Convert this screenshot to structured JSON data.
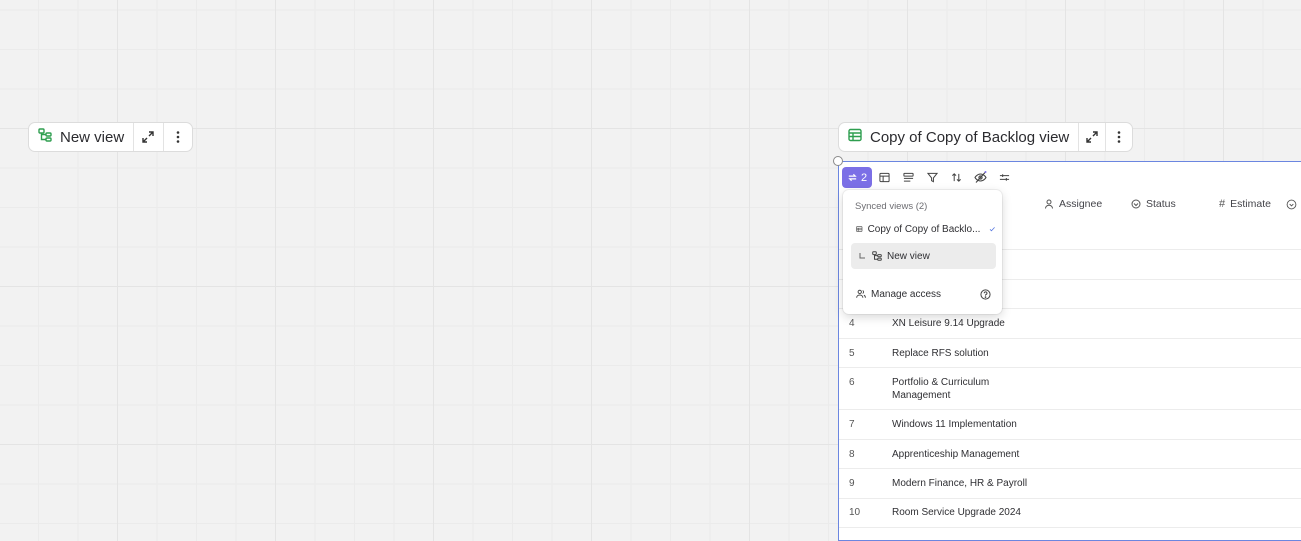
{
  "left_card": {
    "title": "New view",
    "icon": "hierarchy-icon"
  },
  "right_card": {
    "title": "Copy of Copy of Backlog view",
    "icon": "table-icon"
  },
  "toolbar": {
    "synced_count": "2"
  },
  "columns": {
    "assignee": "Assignee",
    "status": "Status",
    "estimate": "Estimate"
  },
  "synced_popup": {
    "heading": "Synced views (2)",
    "items": [
      {
        "label": "Copy of Copy of Backlo...",
        "selected": true
      },
      {
        "label": "New view",
        "selected": false
      }
    ],
    "manage_access": "Manage access"
  },
  "rows": [
    {
      "num": "4",
      "name": "XN Leisure 9.14 Upgrade"
    },
    {
      "num": "5",
      "name": "Replace RFS solution"
    },
    {
      "num": "6",
      "name": "Portfolio & Curriculum Management"
    },
    {
      "num": "7",
      "name": "Windows 11 Implementation"
    },
    {
      "num": "8",
      "name": "Apprenticeship Management"
    },
    {
      "num": "9",
      "name": "Modern Finance, HR & Payroll"
    },
    {
      "num": "10",
      "name": "Room Service Upgrade 2024"
    }
  ],
  "colors": {
    "accent": "#7b6fe6",
    "selection": "#6b86e0",
    "green_icon": "#2e9e4f"
  }
}
